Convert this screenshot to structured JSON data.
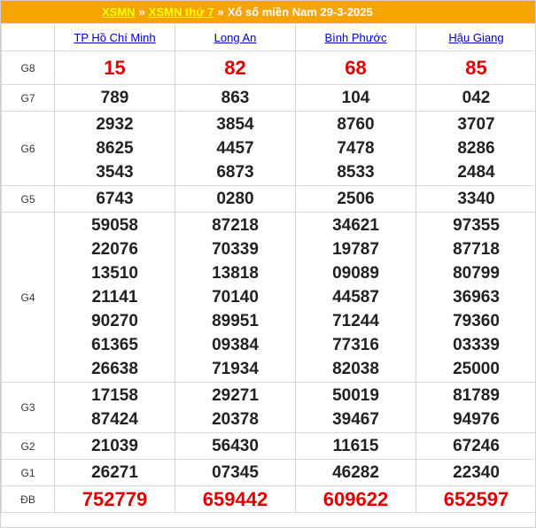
{
  "header": {
    "crumb1": "XSMN",
    "sep1": "»",
    "crumb2": "XSMN thứ 7",
    "sep2": "»",
    "title": "Xổ số miền Nam 29-3-2025"
  },
  "provinces": [
    "TP Hồ Chí Minh",
    "Long An",
    "Bình Phước",
    "Hậu Giang"
  ],
  "prizes": [
    {
      "label": "G8",
      "results": [
        [
          "15"
        ],
        [
          "82"
        ],
        [
          "68"
        ],
        [
          "85"
        ]
      ]
    },
    {
      "label": "G7",
      "results": [
        [
          "789"
        ],
        [
          "863"
        ],
        [
          "104"
        ],
        [
          "042"
        ]
      ]
    },
    {
      "label": "G6",
      "results": [
        [
          "2932",
          "8625",
          "3543"
        ],
        [
          "3854",
          "4457",
          "6873"
        ],
        [
          "8760",
          "7478",
          "8533"
        ],
        [
          "3707",
          "8286",
          "2484"
        ]
      ]
    },
    {
      "label": "G5",
      "results": [
        [
          "6743"
        ],
        [
          "0280"
        ],
        [
          "2506"
        ],
        [
          "3340"
        ]
      ]
    },
    {
      "label": "G4",
      "results": [
        [
          "59058",
          "22076",
          "13510",
          "21141",
          "90270",
          "61365",
          "26638"
        ],
        [
          "87218",
          "70339",
          "13818",
          "70140",
          "89951",
          "09384",
          "71934"
        ],
        [
          "34621",
          "19787",
          "09089",
          "44587",
          "71244",
          "77316",
          "82038"
        ],
        [
          "97355",
          "87718",
          "80799",
          "36963",
          "79360",
          "03339",
          "25000"
        ]
      ]
    },
    {
      "label": "G3",
      "results": [
        [
          "17158",
          "87424"
        ],
        [
          "29271",
          "20378"
        ],
        [
          "50019",
          "39467"
        ],
        [
          "81789",
          "94976"
        ]
      ]
    },
    {
      "label": "G2",
      "results": [
        [
          "21039"
        ],
        [
          "56430"
        ],
        [
          "11615"
        ],
        [
          "67246"
        ]
      ]
    },
    {
      "label": "G1",
      "results": [
        [
          "26271"
        ],
        [
          "07345"
        ],
        [
          "46282"
        ],
        [
          "22340"
        ]
      ]
    },
    {
      "label": "ĐB",
      "results": [
        [
          "752779"
        ],
        [
          "659442"
        ],
        [
          "609622"
        ],
        [
          "652597"
        ]
      ]
    }
  ]
}
